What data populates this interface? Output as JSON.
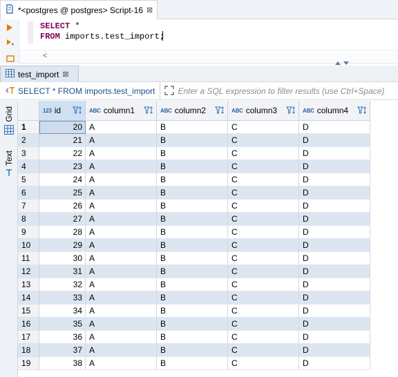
{
  "script_tab": {
    "title": "*<postgres @ postgres> Script-16",
    "close": "⊠"
  },
  "editor": {
    "line1_kw": "SELECT",
    "line1_rest": " *",
    "line2_kw": "FROM",
    "line2_rest": " imports.test_import;",
    "scroll_left": "<"
  },
  "results_tab": {
    "title": "test_import",
    "close": "⊠"
  },
  "filter": {
    "query": "SELECT * FROM imports.test_import",
    "placeholder": "Enter a SQL expression to filter results (use Ctrl+Space)"
  },
  "side_tabs": {
    "grid": "Grid",
    "text": "Text"
  },
  "grid": {
    "columns": [
      {
        "type": "123",
        "name": "id"
      },
      {
        "type": "ABC",
        "name": "column1"
      },
      {
        "type": "ABC",
        "name": "column2"
      },
      {
        "type": "ABC",
        "name": "column3"
      },
      {
        "type": "ABC",
        "name": "column4"
      }
    ],
    "rows": [
      {
        "n": "1",
        "id": "20",
        "c1": "A",
        "c2": "B",
        "c3": "C",
        "c4": "D"
      },
      {
        "n": "2",
        "id": "21",
        "c1": "A",
        "c2": "B",
        "c3": "C",
        "c4": "D"
      },
      {
        "n": "3",
        "id": "22",
        "c1": "A",
        "c2": "B",
        "c3": "C",
        "c4": "D"
      },
      {
        "n": "4",
        "id": "23",
        "c1": "A",
        "c2": "B",
        "c3": "C",
        "c4": "D"
      },
      {
        "n": "5",
        "id": "24",
        "c1": "A",
        "c2": "B",
        "c3": "C",
        "c4": "D"
      },
      {
        "n": "6",
        "id": "25",
        "c1": "A",
        "c2": "B",
        "c3": "C",
        "c4": "D"
      },
      {
        "n": "7",
        "id": "26",
        "c1": "A",
        "c2": "B",
        "c3": "C",
        "c4": "D"
      },
      {
        "n": "8",
        "id": "27",
        "c1": "A",
        "c2": "B",
        "c3": "C",
        "c4": "D"
      },
      {
        "n": "9",
        "id": "28",
        "c1": "A",
        "c2": "B",
        "c3": "C",
        "c4": "D"
      },
      {
        "n": "10",
        "id": "29",
        "c1": "A",
        "c2": "B",
        "c3": "C",
        "c4": "D"
      },
      {
        "n": "11",
        "id": "30",
        "c1": "A",
        "c2": "B",
        "c3": "C",
        "c4": "D"
      },
      {
        "n": "12",
        "id": "31",
        "c1": "A",
        "c2": "B",
        "c3": "C",
        "c4": "D"
      },
      {
        "n": "13",
        "id": "32",
        "c1": "A",
        "c2": "B",
        "c3": "C",
        "c4": "D"
      },
      {
        "n": "14",
        "id": "33",
        "c1": "A",
        "c2": "B",
        "c3": "C",
        "c4": "D"
      },
      {
        "n": "15",
        "id": "34",
        "c1": "A",
        "c2": "B",
        "c3": "C",
        "c4": "D"
      },
      {
        "n": "16",
        "id": "35",
        "c1": "A",
        "c2": "B",
        "c3": "C",
        "c4": "D"
      },
      {
        "n": "17",
        "id": "36",
        "c1": "A",
        "c2": "B",
        "c3": "C",
        "c4": "D"
      },
      {
        "n": "18",
        "id": "37",
        "c1": "A",
        "c2": "B",
        "c3": "C",
        "c4": "D"
      },
      {
        "n": "19",
        "id": "38",
        "c1": "A",
        "c2": "B",
        "c3": "C",
        "c4": "D"
      }
    ]
  },
  "colors": {
    "accent": "#3a73b5",
    "keyword": "#7f0055",
    "row_stripe": "#dce6f1",
    "selected_header": "#cfe0f3"
  },
  "icons": {
    "script": "script-icon",
    "run": "run-icon",
    "grid": "grid-icon",
    "text": "text-icon",
    "filter": "filter-sort-icon",
    "expand": "expand-icon"
  }
}
